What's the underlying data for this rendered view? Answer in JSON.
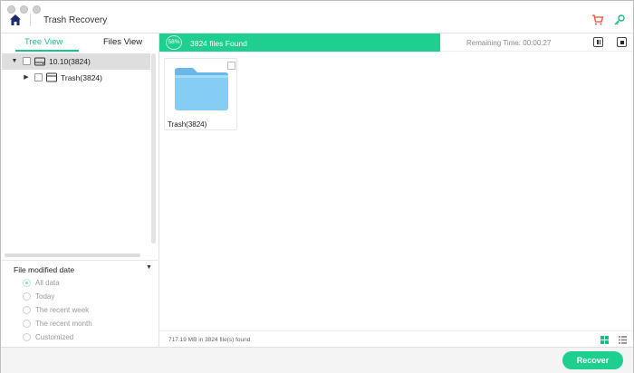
{
  "window": {
    "title": "Trash Recovery"
  },
  "colors": {
    "accent": "#1fcf8f",
    "tab_active": "#1fb98a",
    "cart_icon": "#e74c3c",
    "key_icon": "#1fb98a",
    "folder": "#7ec8f0"
  },
  "icons": {
    "home": "home-icon",
    "cart": "cart-icon",
    "key": "key-icon"
  },
  "tabs": {
    "tree_view": "Tree View",
    "files_view": "Files View"
  },
  "tree": [
    {
      "label": "10.10(3824)",
      "expanded": true,
      "selected": true
    },
    {
      "label": "Trash(3824)",
      "expanded": false,
      "selected": false
    }
  ],
  "filter": {
    "title": "File modified date",
    "options": [
      "All data",
      "Today",
      "The recent week",
      "The recent month",
      "Customized"
    ],
    "selected": "All data"
  },
  "scan": {
    "percent": "58%",
    "progress": 0.58,
    "found_text": "3824 files Found",
    "remaining": "Remaining Time: 00:00:27"
  },
  "files": [
    {
      "label": "Trash(3824)"
    }
  ],
  "status": {
    "summary": "717.19 MB in 3824 file(s) found"
  },
  "actions": {
    "recover": "Recover"
  }
}
